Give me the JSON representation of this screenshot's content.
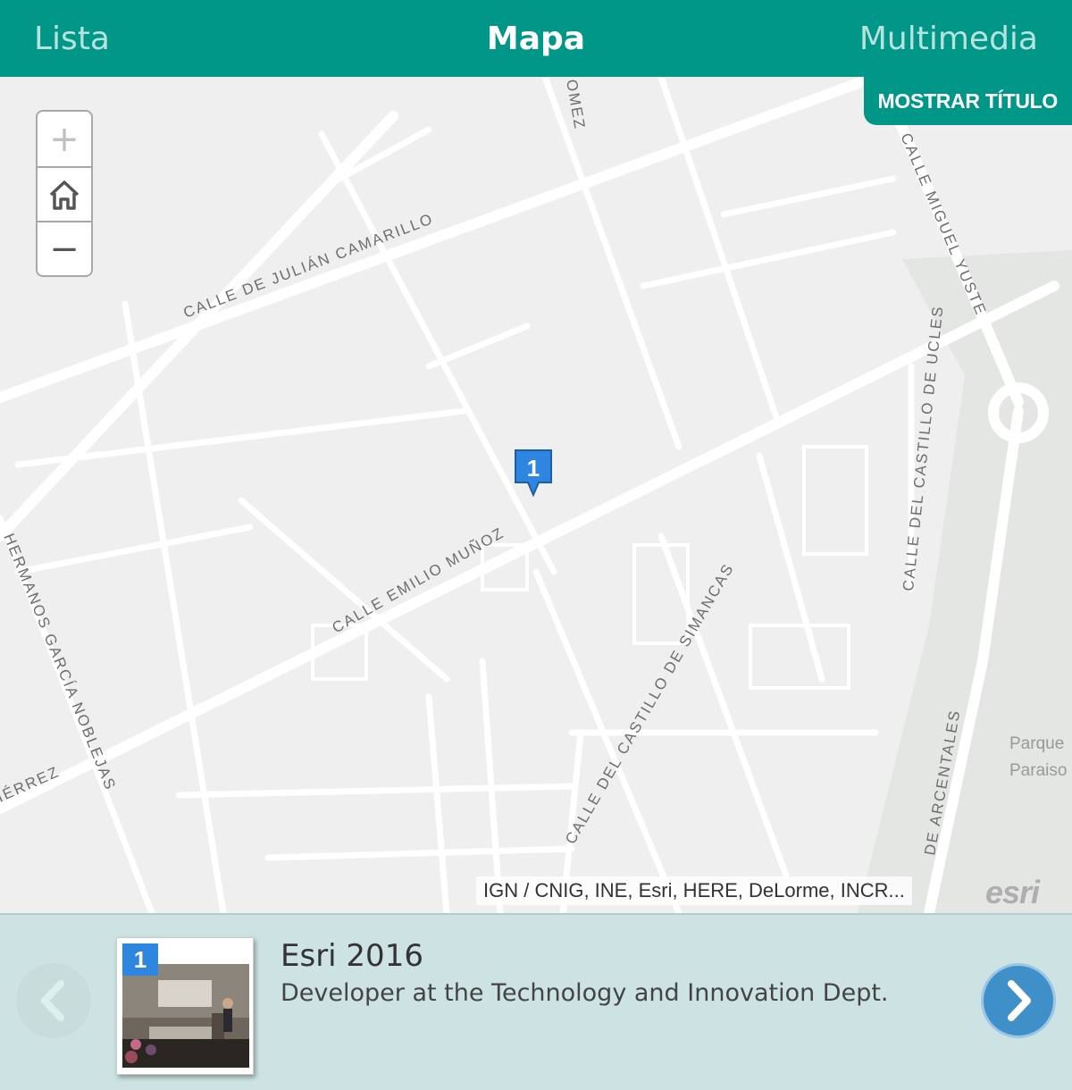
{
  "tabs": {
    "lista": "Lista",
    "mapa": "Mapa",
    "multimedia": "Multimedia"
  },
  "map": {
    "show_title_label": "MOSTRAR TÍTULO",
    "zoom_in_symbol": "+",
    "zoom_out_symbol": "−",
    "marker_number": "1",
    "attribution": "IGN / CNIG, INE, Esri, HERE, DeLorme, INCR...",
    "logo_text": "esri",
    "park_label_1": "Parque",
    "park_label_2": "Paraiso",
    "streets": {
      "julian_camarillo": "CALLE DE JULIÁN CAMARILLO",
      "emilio_munoz": "CALLE EMILIO MUÑOZ",
      "miguel_yuste": "CALLE MIGUEL YUSTE",
      "castillo_de_ucles": "CALLE DEL CASTILLO DE UCLES",
      "castillo_de_simancas": "CALLE DEL CASTILLO DE SIMANCAS",
      "hermanos_garcia_noblejas": "HERMANOS GARCÍA NOBLEJAS",
      "arcentales": "DE ARCENTALES",
      "gomez": "OMEZ",
      "gutierrez": "IÉRREZ"
    }
  },
  "carousel": {
    "badge_number": "1",
    "title": "Esri 2016",
    "subtitle": "Developer at the Technology and Innovation Dept."
  },
  "colors": {
    "header_teal": "#009688",
    "marker_blue": "#2f86e0",
    "next_button_blue": "#3f8fc8",
    "carousel_bg": "#cde3e3"
  },
  "icons": {
    "zoom_in": "plus-icon",
    "home": "home-icon",
    "zoom_out": "minus-icon",
    "prev": "chevron-left-icon",
    "next": "chevron-right-icon",
    "marker": "map-pin-icon"
  }
}
